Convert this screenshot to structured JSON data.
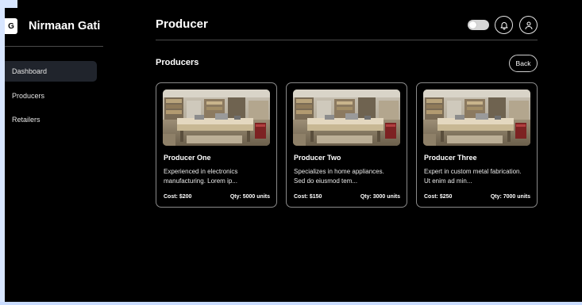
{
  "brand": {
    "logo_letter": "G",
    "name": "Nirmaan Gati"
  },
  "sidebar": {
    "items": [
      {
        "label": "Dashboard",
        "active": true
      },
      {
        "label": "Producers",
        "active": false
      },
      {
        "label": "Retailers",
        "active": false
      }
    ]
  },
  "header": {
    "title": "Producer",
    "toggle": {
      "state": "off",
      "icon": "theme-toggle"
    },
    "icons": [
      "bell-icon",
      "user-icon"
    ]
  },
  "section": {
    "title": "Producers",
    "back_label": "Back"
  },
  "cards": [
    {
      "title": "Producer One",
      "desc_line1": "Experienced in electronics",
      "desc_line2": "manufacturing. Lorem ip...",
      "cost": "Cost: $200",
      "qty": "Qty: 5000 units"
    },
    {
      "title": "Producer Two",
      "desc_line1": "Specializes in home appliances.",
      "desc_line2": "Sed do eiusmod tem...",
      "cost": "Cost: $150",
      "qty": "Qty: 3000 units"
    },
    {
      "title": "Producer Three",
      "desc_line1": "Expert in custom metal fabrication.",
      "desc_line2": "Ut enim ad min...",
      "cost": "Cost: $250",
      "qty": "Qty: 7000 units"
    }
  ],
  "colors": {
    "background": "#000000",
    "active_nav": "#20242c",
    "card_border": "#8a8a8a",
    "edge": "#d8e6ff"
  }
}
